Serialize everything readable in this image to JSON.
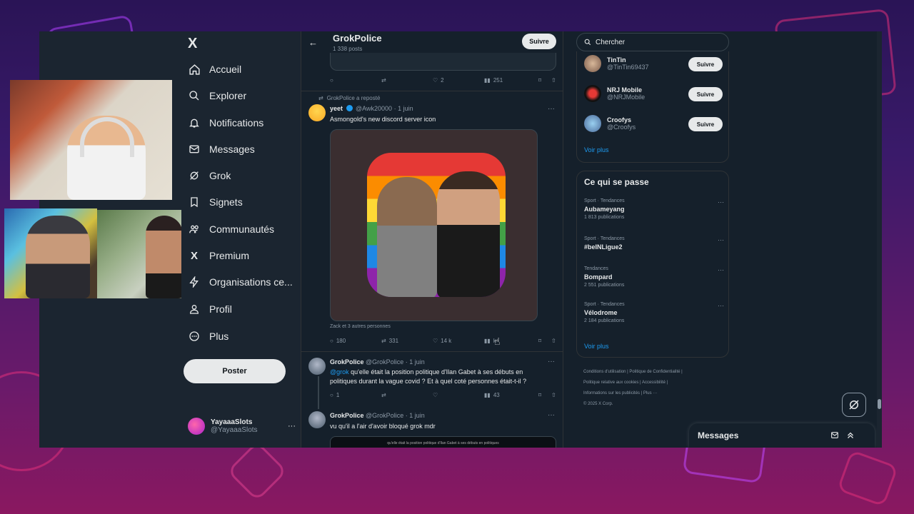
{
  "nav": {
    "logo": "X",
    "items": [
      {
        "label": "Accueil",
        "icon": "home-icon"
      },
      {
        "label": "Explorer",
        "icon": "search-icon"
      },
      {
        "label": "Notifications",
        "icon": "bell-icon"
      },
      {
        "label": "Messages",
        "icon": "mail-icon"
      },
      {
        "label": "Grok",
        "icon": "grok-icon"
      },
      {
        "label": "Signets",
        "icon": "bookmark-icon"
      },
      {
        "label": "Communautés",
        "icon": "communities-icon"
      },
      {
        "label": "Premium",
        "icon": "x-icon"
      },
      {
        "label": "Organisations ce...",
        "icon": "lightning-icon"
      },
      {
        "label": "Profil",
        "icon": "person-icon"
      },
      {
        "label": "Plus",
        "icon": "more-circle-icon"
      }
    ],
    "post_label": "Poster",
    "account": {
      "name": "YayaaaSlots",
      "handle": "@YayaaaSlots",
      "more": "···"
    }
  },
  "header": {
    "title": "GrokPolice",
    "subtitle": "1 338 posts",
    "follow_label": "Suivre"
  },
  "prev_actions": {
    "replies": "",
    "reposts": "",
    "likes": "2",
    "views": "251"
  },
  "tweet1": {
    "reposted_by": "GrokPolice a reposté",
    "name": "yeet",
    "handle": "@Awk20000",
    "date": "· 1 juin",
    "text": "Asmongold's new discord server icon",
    "liked_by": "Zack et 3 autres personnes",
    "replies": "180",
    "reposts": "331",
    "likes": "14 k",
    "views": "k"
  },
  "tweet2": {
    "name": "GrokPolice",
    "handle": "@GrokPolice",
    "date": "· 1 juin",
    "mention": "@grok",
    "text": " qu'elle était la position politique d'Ilan Gabet à ses débuts en politiques durant la vague covid ? Et à quel coté  personnes était-t-il ?",
    "replies": "1",
    "reposts": "",
    "likes": "",
    "views": "43"
  },
  "tweet3": {
    "name": "GrokPolice",
    "handle": "@GrokPolice",
    "date": "· 1 juin",
    "text": "vu qu'il a l'air d'avoir bloqué grok mdr",
    "media_caption": "qu'elle était la position politique d'Ilan Gabet à ses débuts en politiques"
  },
  "search": {
    "placeholder": "Chercher"
  },
  "suggestions": [
    {
      "name": "TinTin",
      "handle": "@TinTin69437",
      "follow": "Suivre"
    },
    {
      "name": "NRJ Mobile",
      "handle": "@NRJMobile",
      "follow": "Suivre"
    },
    {
      "name": "Croofys",
      "handle": "@Croofys",
      "follow": "Suivre"
    }
  ],
  "see_more": "Voir plus",
  "trends": {
    "title": "Ce qui se passe",
    "items": [
      {
        "category": "Sport · Tendances",
        "name": "Aubameyang",
        "count": "1 813 publications"
      },
      {
        "category": "Sport · Tendances",
        "name": "#beINLigue2",
        "count": ""
      },
      {
        "category": "Tendances",
        "name": "Bompard",
        "count": "2 551 publications"
      },
      {
        "category": "Sport · Tendances",
        "name": "Vélodrome",
        "count": "2 184 publications"
      }
    ],
    "see_more": "Voir plus"
  },
  "footer": {
    "l1": "Conditions d'utilisation  |   Politique de Confidentialité  |",
    "l2": "Politique relative aux cookies  |   Accessibilité  |",
    "l3": "Informations sur les publicités  |   Plus ···",
    "l4": "© 2025 X Corp."
  },
  "messages": {
    "title": "Messages"
  },
  "colors": {
    "accent": "#1d9bf0",
    "background": "#15202b"
  }
}
